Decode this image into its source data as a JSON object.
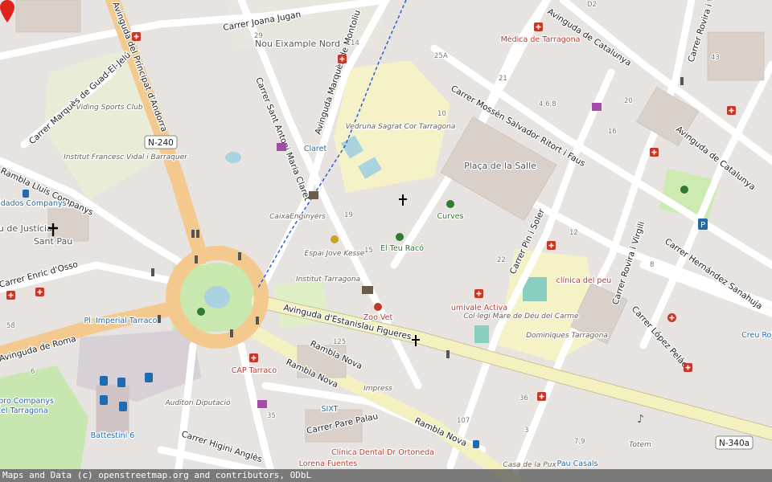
{
  "map": {
    "attribution": "Maps and Data (c) openstreetmap.org and contributors, ODbL",
    "colors": {
      "background": "#e0dfdf",
      "major_road": "#f7d9a4",
      "secondary_road": "#f7f4c6",
      "minor_road": "#ffffff",
      "park": "#cdebb0",
      "school": "#f0f0d8",
      "water": "#aad3df",
      "marker": "#e0231a"
    },
    "streets": [
      "Avinguda del Príncipat d'Andorra",
      "Carrer Joana Jugan",
      "Carrer Marquès de Guad-El-Jelú",
      "Rambla Lluís Companys",
      "Avinguda Marquès de Montoliu",
      "Carrer Sant Antoni Maria Claret",
      "Carrer Mossèn Salvador Ritort i Faus",
      "Avinguda de Catalunya",
      "Avinguda de Catalunya",
      "Carrer Rovira i Virgili",
      "Carrer Rovira i V",
      "Carrer Hernández Sanahuja",
      "Carrer Pin i Soler",
      "Carrer López Peláez",
      "Avinguda d'Estanislau Figueres",
      "Rambla Nova",
      "Rambla Nova",
      "Rambla Nova",
      "Carrer Pare Palau",
      "Carrer Higini Anglès",
      "Avinguda de Roma",
      "Carrer Enric d'Osso"
    ],
    "route_shields": [
      "N-240",
      "N-340a"
    ],
    "places": [
      "Nou Eixample Nord",
      "Plaça de la Salle",
      "Viding Sports Club",
      "Institut Francesc Vidal i Barraquer",
      "Vedruna Sagrat Cor Tarragona",
      "Institut Tarragona",
      "Col·legi Mare de Déu del Carme",
      "Dominiques Tarragona",
      "Clínica Dental Dr Ortoneda",
      "Auditori Diputació",
      "Battestini 6",
      "Sant Pau",
      "Palau de Justícia"
    ],
    "pois": [
      "Mèdica de Tarragona",
      "Claret",
      "CaixaEnginyers",
      "Espai Jove Kesse",
      "El Teu Racó",
      "Curves",
      "Zoo Vet",
      "umivale Activa",
      "clínica del peu",
      "Pl. Imperial Tarraco",
      "CAP Tarraco",
      "Impress",
      "SIXT",
      "Lorena Fuentes",
      "Totem",
      "Casa de la Puxxa",
      "Pau Casals",
      "Creu Roja",
      "Cuidados Companys",
      "Bipro Companys",
      "Hotel Tarragona"
    ],
    "house_numbers": [
      "29",
      "14",
      "25A",
      "21",
      "4,6,8",
      "10",
      "16",
      "19",
      "15",
      "22",
      "12",
      "8",
      "43",
      "20",
      "125",
      "36",
      "107",
      "3",
      "7,9",
      "35",
      "6",
      "58",
      "D2"
    ],
    "marker_label": "selected location"
  }
}
